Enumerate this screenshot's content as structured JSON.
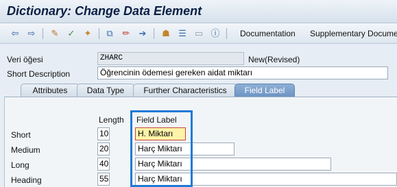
{
  "window": {
    "title": "Dictionary: Change Data Element"
  },
  "toolbar": {
    "documentation": "Documentation",
    "supplementary": "Supplementary Docume"
  },
  "header": {
    "data_element_label": "Veri öğesi",
    "data_element_value": "ZHARC",
    "status": "New(Revised)",
    "short_description_label": "Short Description",
    "short_description_value": "Öğrencinin ödemesi gereken aidat miktarı"
  },
  "tabs": [
    "Attributes",
    "Data Type",
    "Further Characteristics",
    "Field Label"
  ],
  "active_tab": "Field Label",
  "field_label_tab": {
    "length_header": "Length",
    "field_label_header": "Field Label",
    "rows": [
      {
        "label": "Short",
        "length": "10",
        "text": "H. Miktarı"
      },
      {
        "label": "Medium",
        "length": "20",
        "text": "Harç Miktarı"
      },
      {
        "label": "Long",
        "length": "40",
        "text": "Harç Miktarı"
      },
      {
        "label": "Heading",
        "length": "55",
        "text": "Harç Miktarı"
      }
    ]
  },
  "colors": {
    "highlight_border": "#1e7bd6",
    "active_tab": "#7a9fcd",
    "focus_field": "#fff3a8"
  }
}
